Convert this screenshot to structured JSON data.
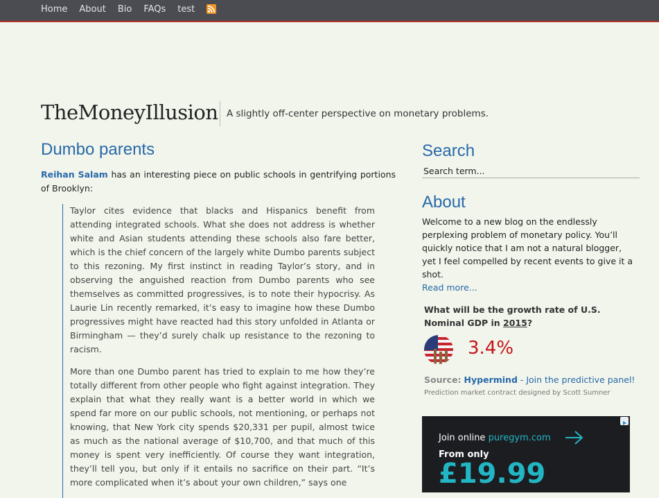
{
  "nav": {
    "items": [
      "Home",
      "About",
      "Bio",
      "FAQs",
      "test"
    ],
    "rss_icon": "rss-feed-icon"
  },
  "header": {
    "site_title": "TheMoneyIllusion",
    "tagline": "A slightly off-center perspective on monetary problems."
  },
  "post": {
    "title": "Dumbo parents",
    "intro_link": "Reihan Salam",
    "intro_rest": " has an interesting piece on public schools in gentrifying portions of Brooklyn:",
    "quote_p1": "Taylor cites evidence that blacks and Hispanics benefit from attending integrated schools. What she does not address is whether white and Asian students attending these schools also fare better, which is the chief concern of the largely white Dumbo parents subject to this rezoning. My first instinct in reading Taylor’s story, and in observing the anguished reaction from Dumbo parents who see themselves as committed progressives, is to note their hypocrisy. As Laurie Lin recently remarked, it’s easy to imagine how these Dumbo progressives might have reacted had this story unfolded in Atlanta or Birmingham — they’d surely chalk up resistance to the rezoning to racism.",
    "quote_p2": "More than one Dumbo parent has tried to explain to me how they’re totally different from other people who fight against integration. They explain that what they really want is a better world in which we spend far more on our public schools, not mentioning, or perhaps not knowing, that New York city spends $20,331 per pupil, almost twice as much as the national average of $10,700, and that much of this money is spent very inefficiently. Of course they want integration, they’ll tell you, but only if it entails no sacrifice on their part. “It’s more complicated when it’s about your own children,” says one"
  },
  "sidebar": {
    "search_heading": "Search",
    "search_placeholder": "Search term...",
    "about_heading": "About",
    "about_text": "Welcome to a new blog on the endlessly perplexing problem of monetary policy. You’ll quickly notice that I am not a natural blogger, yet I feel compelled by recent events to give it a shot.",
    "read_more": "Read more...",
    "widget": {
      "question_pre": "What will be the growth rate of U.S. Nominal GDP in ",
      "question_year": "2015",
      "question_post": "?",
      "value": "3.4%",
      "source_label": "Source:",
      "source_brand": "Hypermind",
      "source_cta": " - Join the predictive panel!",
      "credit": "Prediction market contract designed by Scott Sumner"
    },
    "ad": {
      "line1_pre": "Join online ",
      "line1_brand": "puregym.com",
      "line2": "From only",
      "price": "£19.99"
    }
  },
  "colors": {
    "link": "#2768a8",
    "topbar": "#4a4c52",
    "topbar_border": "#b3302a",
    "value_red": "#c41418",
    "background": "#f2f5ec"
  }
}
